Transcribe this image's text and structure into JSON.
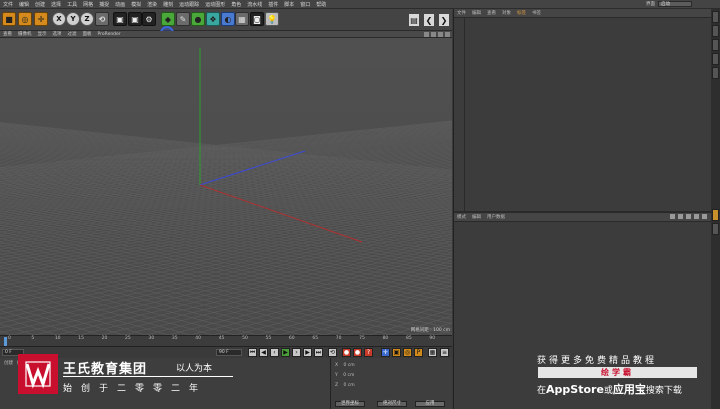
{
  "menubar": {
    "items": [
      "文件",
      "编辑",
      "创建",
      "选择",
      "工具",
      "网格",
      "捕捉",
      "动画",
      "模拟",
      "渲染",
      "雕刻",
      "运动跟踪",
      "运动图形",
      "角色",
      "流水线",
      "插件",
      "脚本",
      "窗口",
      "帮助"
    ],
    "layout_label": "界面",
    "layout_value": "启动"
  },
  "toolbar": {
    "axis_x": "X",
    "axis_y": "Y",
    "axis_z": "Z"
  },
  "viewport_menu": {
    "items": [
      "查看",
      "摄像机",
      "显示",
      "选项",
      "过滤",
      "面板",
      "ProRender"
    ]
  },
  "viewport": {
    "grid_spacing": "网格间距 : 100 cm",
    "colors": {
      "x_axis": "#b03030",
      "y_axis": "#2ea02e",
      "z_axis": "#3a4ad8",
      "grid": "#5e5e5e",
      "bg": "#4d4d4d"
    }
  },
  "timeline": {
    "ticks": [
      "0",
      "5",
      "10",
      "15",
      "20",
      "25",
      "30",
      "35",
      "40",
      "45",
      "50",
      "55",
      "60",
      "65",
      "70",
      "75",
      "80",
      "85",
      "90"
    ],
    "end_frame": "0 F",
    "current_frame": "0 F",
    "max_frame": "90 F",
    "total_frames": "90 F"
  },
  "lower_panel": {
    "tabs": [
      "创建",
      "编辑",
      "功能",
      "纹理"
    ]
  },
  "coordinates": {
    "rows": [
      {
        "axis": "X",
        "value": "0 cm"
      },
      {
        "axis": "Y",
        "value": "0 cm"
      },
      {
        "axis": "Z",
        "value": "0 cm"
      }
    ],
    "world_label": "世界坐标",
    "scale_label": "绝对尺寸",
    "apply_label": "应用"
  },
  "object_manager": {
    "tabs": [
      "文件",
      "编辑",
      "查看",
      "对象",
      "标签",
      "书签"
    ]
  },
  "attribute_manager": {
    "tabs": [
      "模式",
      "编辑",
      "用户数据"
    ]
  },
  "watermark": {
    "name": "王氏教育集团",
    "motto": "以人为本",
    "subtitle": "始创于二零零二年"
  },
  "promo": {
    "title": "获得更多免费精品教程",
    "brand": "绘学霸",
    "bottom_prefix": "在",
    "store1": "AppStore",
    "bottom_mid": "或",
    "store2": "应用宝",
    "bottom_suffix": "搜索下载"
  }
}
